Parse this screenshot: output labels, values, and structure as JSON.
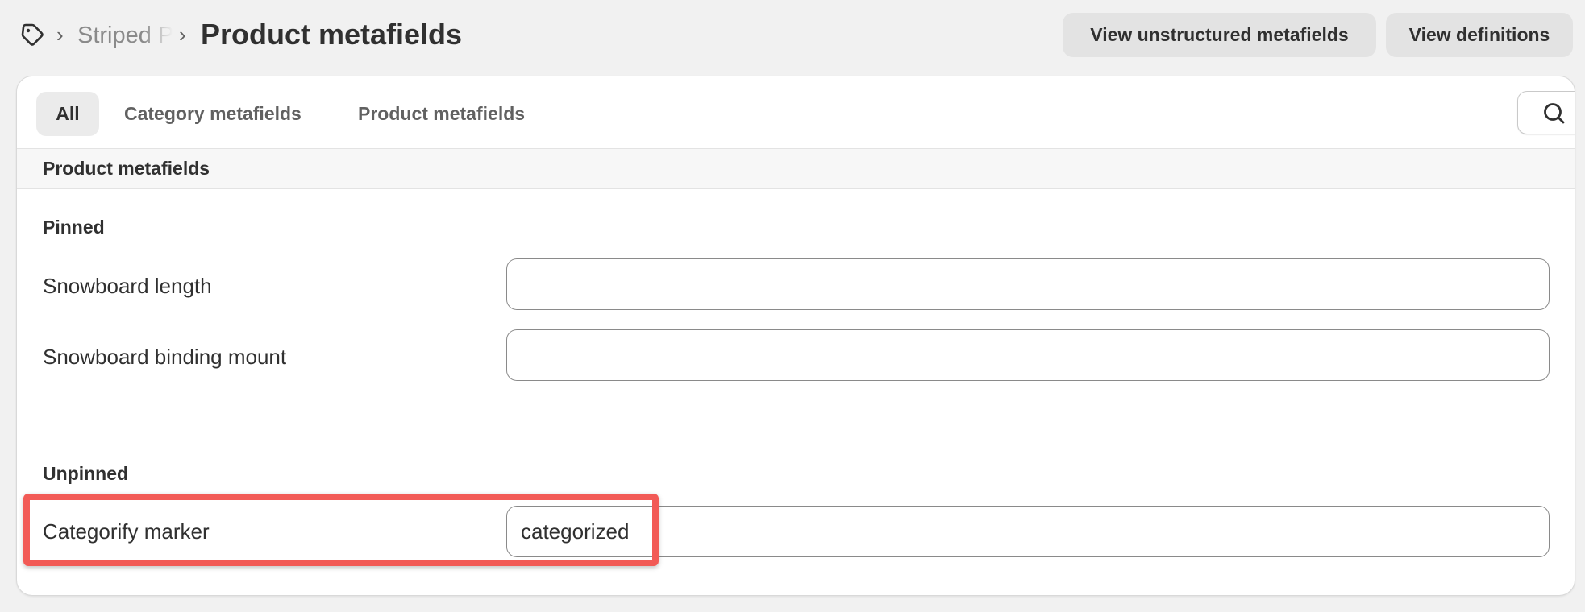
{
  "header": {
    "breadcrumb_parent": "Striped Pride",
    "title": "Product metafields",
    "buttons": {
      "unstructured": "View unstructured metafields",
      "definitions": "View definitions"
    }
  },
  "tabs": [
    {
      "label": "All",
      "active": true
    },
    {
      "label": "Category metafields",
      "active": false
    },
    {
      "label": "Product metafields",
      "active": false
    }
  ],
  "section": {
    "title": "Product metafields",
    "pinned": {
      "title": "Pinned",
      "rows": [
        {
          "label": "Snowboard length",
          "value": ""
        },
        {
          "label": "Snowboard binding mount",
          "value": ""
        }
      ]
    },
    "unpinned": {
      "title": "Unpinned",
      "rows": [
        {
          "label": "Categorify marker",
          "value": "categorized"
        }
      ]
    }
  },
  "colors": {
    "highlight": "#f25a56",
    "background": "#f1f1f1"
  },
  "icons": [
    "tag-icon",
    "chevron-right-icon",
    "search-icon"
  ]
}
